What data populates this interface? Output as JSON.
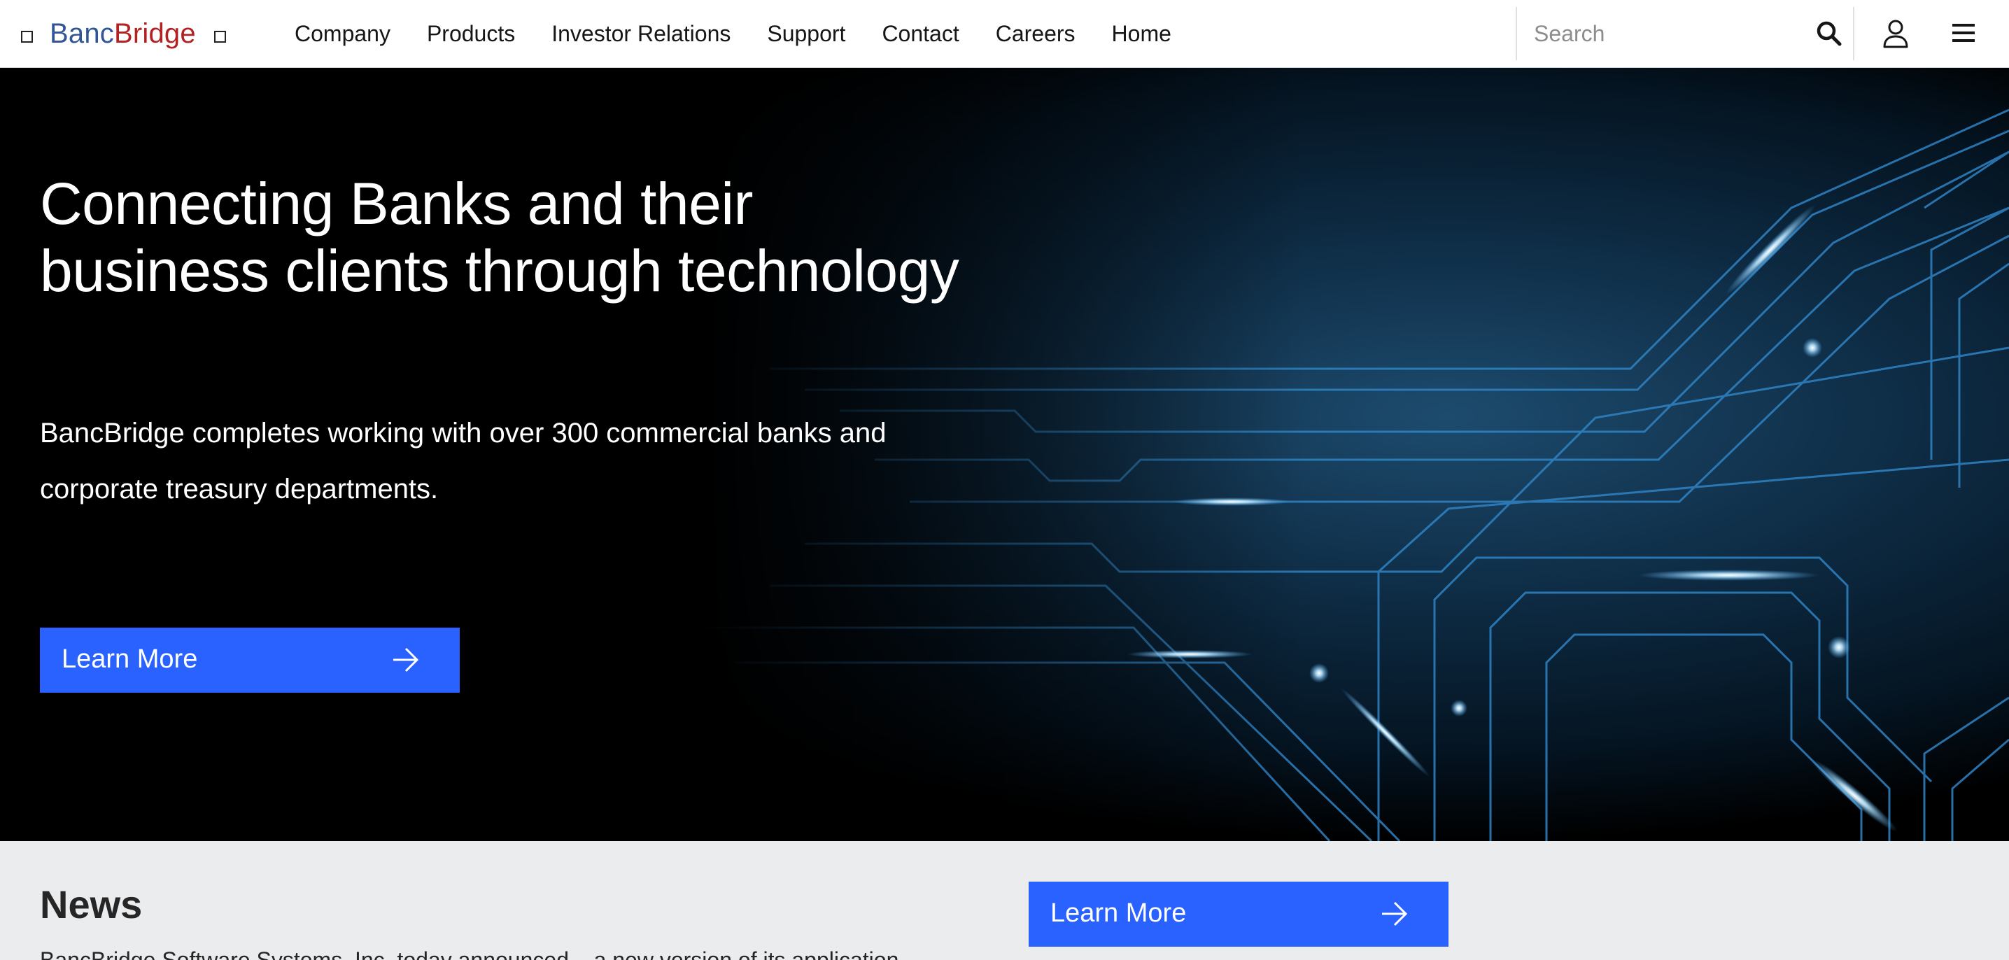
{
  "brand": {
    "name_part1": "Banc",
    "name_part2": "Bridge",
    "color_part1": "#2f5597",
    "color_part2": "#b22222"
  },
  "nav": {
    "items": [
      {
        "label": "Company"
      },
      {
        "label": "Products"
      },
      {
        "label": "Investor Relations"
      },
      {
        "label": "Support"
      },
      {
        "label": "Contact"
      },
      {
        "label": "Careers"
      },
      {
        "label": "Home"
      }
    ]
  },
  "search": {
    "placeholder": "Search",
    "value": "",
    "icon": "search-icon"
  },
  "header_icons": {
    "user": "user-icon",
    "menu": "hamburger-menu-icon"
  },
  "hero": {
    "title": "Connecting Banks and their business clients through technology",
    "text": "BancBridge completes working with over 300 commercial banks and corporate treasury departments.",
    "button_label": "Learn More",
    "button_icon": "arrow-right-icon",
    "accent_color": "#2962ff"
  },
  "news": {
    "title": "News",
    "snippet": "BancBridge Software Systems, Inc. today announced – a new version of its application",
    "button_label": "Learn More",
    "button_icon": "arrow-right-icon"
  }
}
